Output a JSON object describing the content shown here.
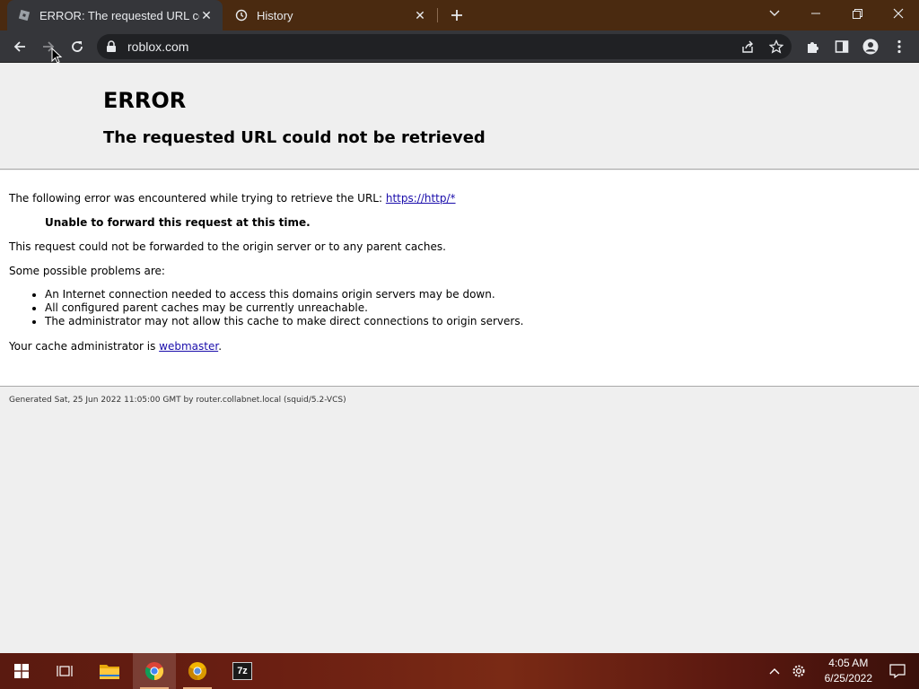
{
  "browser": {
    "tabs": [
      {
        "title": "ERROR: The requested URL could not be retrieved",
        "active": true
      },
      {
        "title": "History",
        "active": false
      }
    ],
    "address": "roblox.com",
    "icons": {
      "back": "arrow-left-icon",
      "forward": "arrow-right-icon",
      "reload": "reload-icon",
      "share": "share-icon",
      "bookmark": "star-icon",
      "extensions": "puzzle-icon",
      "side_panel": "side-panel-icon",
      "profile": "profile-icon",
      "menu": "kebab-menu-icon"
    }
  },
  "error_page": {
    "title": "ERROR",
    "subtitle": "The requested URL could not be retrieved",
    "intro": "The following error was encountered while trying to retrieve the URL: ",
    "url_link": "https://http/*",
    "emphasis": "Unable to forward this request at this time.",
    "detail": "This request could not be forwarded to the origin server or to any parent caches.",
    "problems_heading": "Some possible problems are:",
    "problems": [
      "An Internet connection needed to access this domains origin servers may be down.",
      "All configured parent caches may be currently unreachable.",
      "The administrator may not allow this cache to make direct connections to origin servers."
    ],
    "admin_prefix": "Your cache administrator is ",
    "admin_link": "webmaster",
    "admin_suffix": ".",
    "footer": "Generated Sat, 25 Jun 2022 11:05:00 GMT by router.collabnet.local (squid/5.2-VCS)"
  },
  "taskbar": {
    "apps": [
      "windows-start-icon",
      "task-view-icon",
      "file-explorer-icon",
      "chrome-icon",
      "chrome-canary-icon",
      "7zip-icon"
    ],
    "seven_zip_label": "7z",
    "time": "4:05 AM",
    "date": "6/25/2022"
  },
  "colors": {
    "link": "#1a0dab",
    "chrome_dark": "#35363a",
    "tabstrip": "#4a2a10"
  }
}
